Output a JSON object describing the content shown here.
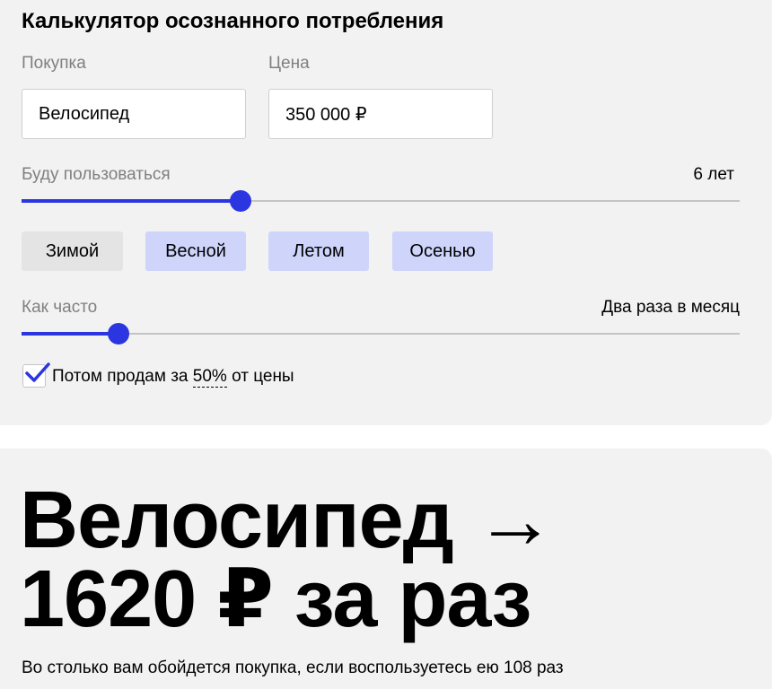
{
  "calculator": {
    "title": "Калькулятор осознанного потребления",
    "purchase": {
      "label": "Покупка",
      "value": "Велосипед"
    },
    "price": {
      "label": "Цена",
      "value": "350 000 ₽"
    },
    "duration": {
      "label": "Буду пользоваться",
      "value_text": "6 лет",
      "slider_fraction": 0.305
    },
    "seasons": [
      {
        "label": "Зимой",
        "selected": false
      },
      {
        "label": "Весной",
        "selected": true
      },
      {
        "label": "Летом",
        "selected": true
      },
      {
        "label": "Осенью",
        "selected": true
      }
    ],
    "frequency": {
      "label": "Как часто",
      "value_text": "Два раза в месяц",
      "slider_fraction": 0.135
    },
    "resale": {
      "checked": true,
      "text_before": "Потом продам за",
      "percent": "50%",
      "text_after": "от цены"
    }
  },
  "result": {
    "line1": "Велосипед →",
    "line2": "1620 ₽ за раз",
    "note": "Во столько вам обойдется покупка, если воспользуетесь ею 108 раз"
  },
  "colors": {
    "accent": "#2b35e0",
    "season_selected": "#cfd4fb",
    "season_unselected": "#e4e4e4",
    "card_background": "#f2f2f2"
  }
}
